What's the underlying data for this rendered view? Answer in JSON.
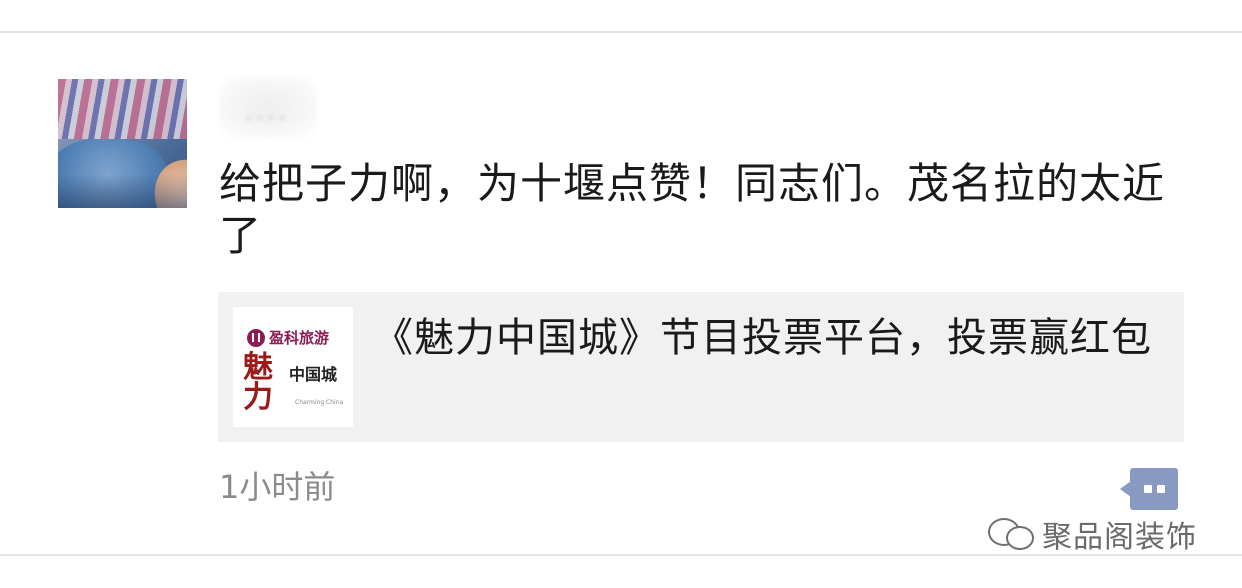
{
  "post": {
    "text": "给把子力啊，为十堰点赞！同志们。茂名拉的太近了",
    "timestamp": "1小时前"
  },
  "link_card": {
    "title": "《魅力中国城》节目投票平台，投票赢红包",
    "thumb_brand": "盈科旅游",
    "thumb_big": "魅力",
    "thumb_small": "中国城",
    "thumb_sub": "Charming China"
  },
  "watermark": {
    "text": "聚品阁装饰"
  },
  "icons": {
    "comment": "comment-icon",
    "wechat": "wechat-icon"
  },
  "colors": {
    "comment_button": "#8899c2",
    "timestamp": "#8b8b8b",
    "card_background": "#f1f1f1"
  }
}
